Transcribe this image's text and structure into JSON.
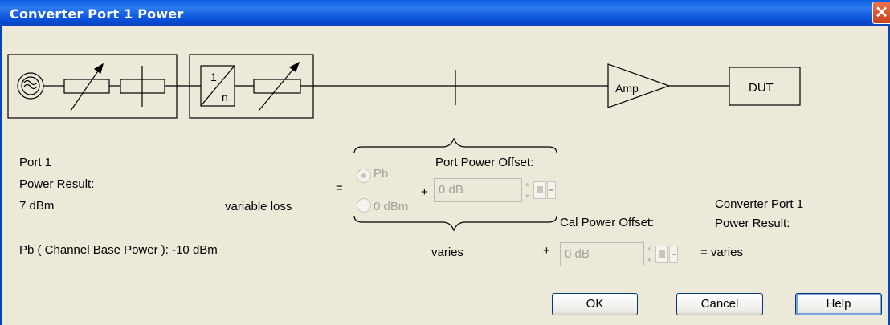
{
  "window": {
    "title": "Converter Port 1 Power",
    "close_glyph": "✕"
  },
  "diagram": {
    "amp_label": "Amp",
    "dut_label": "DUT",
    "divider_num": "1",
    "divider_den": "n"
  },
  "port": {
    "label1": "Port 1",
    "label2": "Power Result:",
    "value": "7 dBm"
  },
  "variable_loss_label": "variable loss",
  "equals_sign": "=",
  "plus_sign": "+",
  "radio": {
    "pb_label": "Pb",
    "zero_label": "0 dBm",
    "selected": "Pb"
  },
  "port_power_offset": {
    "label": "Port Power Offset:",
    "value": "0 dB"
  },
  "cal_power_offset": {
    "label": "Cal Power Offset:",
    "value": "0 dB"
  },
  "channel_base_power": "Pb ( Channel Base Power ): -10 dBm",
  "varies_label": "varies",
  "result": {
    "label1": "Converter Port 1",
    "label2": "Power Result:",
    "value": "= varies"
  },
  "buttons": {
    "ok": "OK",
    "cancel": "Cancel",
    "help": "Help"
  },
  "icons": {
    "source": "sine-source-icon",
    "attenuator": "variable-attenuator-icon",
    "switch": "switch-icon",
    "divider": "frequency-divider-icon",
    "amplifier": "amplifier-icon"
  }
}
